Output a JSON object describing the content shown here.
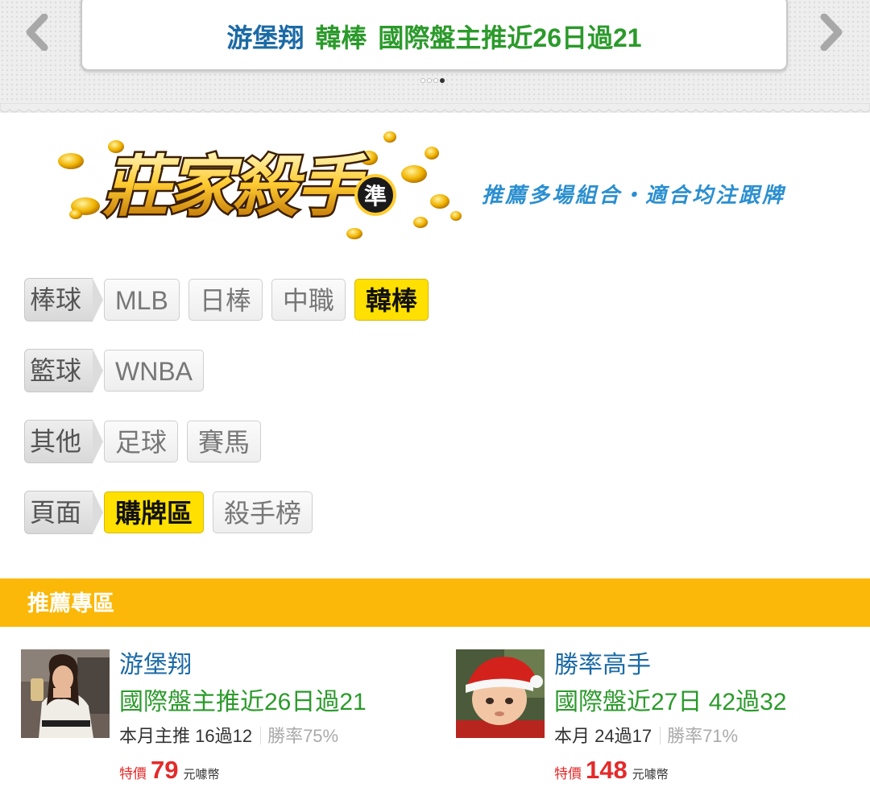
{
  "banner": {
    "headline_name": "游堡翔",
    "headline_league": "韓棒",
    "headline_record": "國際盤主推近26日過21",
    "pager_total": 4,
    "pager_active_index": 3,
    "prev_icon": "chevron-left-icon",
    "next_icon": "chevron-right-icon"
  },
  "logo": {
    "text": "莊家殺手",
    "badge": "準"
  },
  "tagline": "推薦多場組合・適合均注跟牌",
  "filters": {
    "baseball": {
      "label": "棒球",
      "options": [
        "MLB",
        "日棒",
        "中職",
        "韓棒"
      ],
      "active": "韓棒"
    },
    "basketball": {
      "label": "籃球",
      "options": [
        "WNBA"
      ],
      "active": ""
    },
    "other": {
      "label": "其他",
      "options": [
        "足球",
        "賽馬"
      ],
      "active": ""
    },
    "page": {
      "label": "頁面",
      "options": [
        "購牌區",
        "殺手榜"
      ],
      "active": "購牌區"
    }
  },
  "section": {
    "title": "推薦專區"
  },
  "cards": [
    {
      "name": "游堡翔",
      "record": "國際盤主推近26日過21",
      "stats": "本月主推 16過12",
      "winrate": "勝率75%",
      "price_tag": "特價",
      "price": "79",
      "unit": "元噱幣"
    },
    {
      "name": "勝率高手",
      "record": "國際盤近27日 42過32",
      "stats": "本月 24過17",
      "winrate": "勝率71%",
      "price_tag": "特價",
      "price": "148",
      "unit": "元噱幣"
    }
  ],
  "colors": {
    "accent": "#fbb809",
    "active_chip": "#ffe000",
    "name_blue": "#1b6aa5",
    "record_green": "#2b9a2b",
    "price_red": "#e32a2a"
  }
}
